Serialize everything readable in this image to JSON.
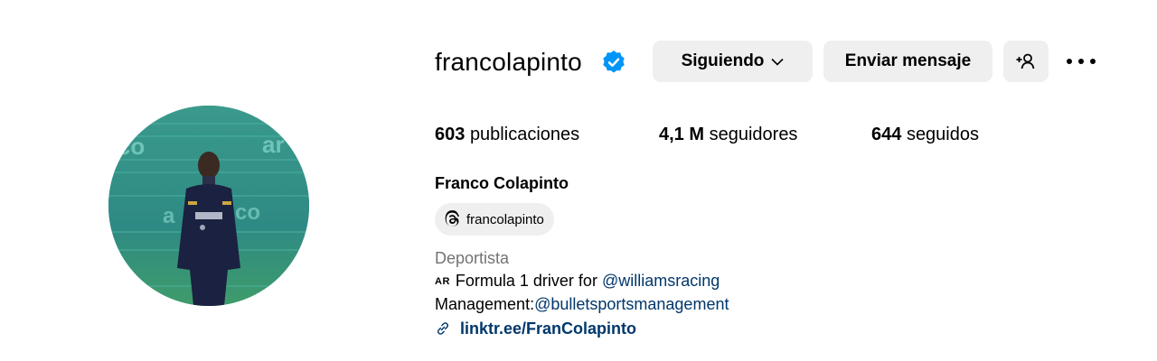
{
  "profile": {
    "username": "francolapinto",
    "verified": true,
    "full_name": "Franco Colapinto",
    "avatar_alt": "francolapinto"
  },
  "actions": {
    "following_label": "Siguiendo",
    "message_label": "Enviar mensaje",
    "suggest_icon": "person-add-icon",
    "more_icon": "more-options-icon"
  },
  "stats": {
    "posts_count": "603",
    "posts_label": "publicaciones",
    "followers_count": "4,1 M",
    "followers_label": "seguidores",
    "following_count": "644",
    "following_label": "seguidos"
  },
  "threads": {
    "handle": "francolapinto",
    "icon": "threads-icon"
  },
  "bio": {
    "category": "Deportista",
    "flag": "AR",
    "line1_text": "Formula 1 driver for ",
    "line1_mention": "@williamsracing",
    "line2_text": "Management:",
    "line2_mention": "@bulletsportsmanagement",
    "link": "linktr.ee/FranColapinto",
    "link_icon": "link-icon"
  },
  "colors": {
    "verified_blue": "#0095f6",
    "button_bg": "#efefef",
    "link_blue": "#00376b",
    "secondary_text": "#737373"
  }
}
